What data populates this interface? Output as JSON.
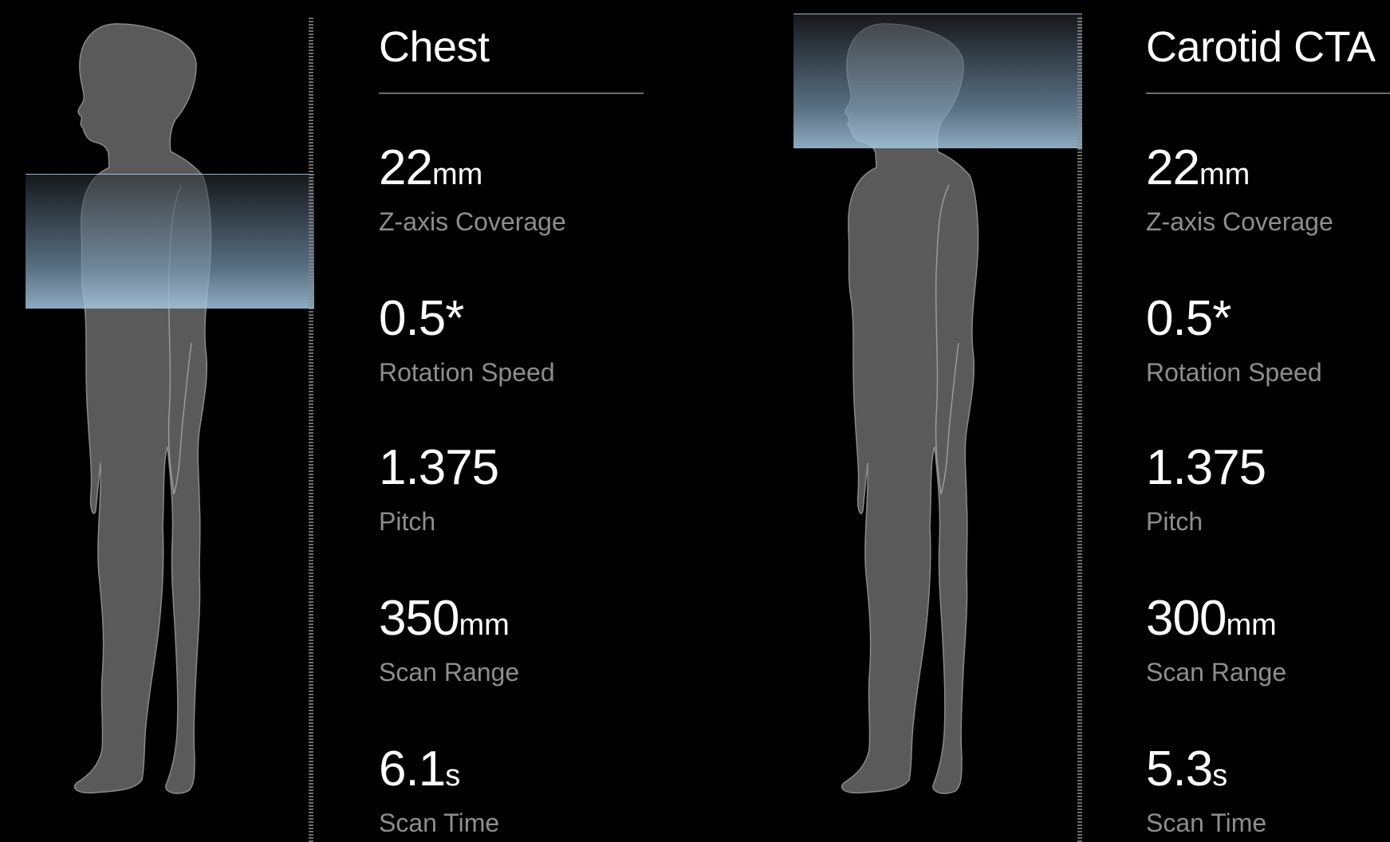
{
  "panels": [
    {
      "title": "Chest",
      "stats": [
        {
          "value": "22",
          "unit": "mm",
          "label": "Z-axis Coverage"
        },
        {
          "value": "0.5*",
          "unit": "",
          "label": "Rotation Speed"
        },
        {
          "value": "1.375",
          "unit": "",
          "label": "Pitch"
        },
        {
          "value": "350",
          "unit": "mm",
          "label": "Scan Range"
        },
        {
          "value": "6.1",
          "unit": "s",
          "label": "Scan Time"
        }
      ]
    },
    {
      "title": "Carotid CTA",
      "stats": [
        {
          "value": "22",
          "unit": "mm",
          "label": "Z-axis Coverage"
        },
        {
          "value": "0.5*",
          "unit": "",
          "label": "Rotation Speed"
        },
        {
          "value": "1.375",
          "unit": "",
          "label": "Pitch"
        },
        {
          "value": "300",
          "unit": "mm",
          "label": "Scan Range"
        },
        {
          "value": "5.3",
          "unit": "s",
          "label": "Scan Time"
        }
      ]
    }
  ],
  "colors": {
    "background": "#000000",
    "body": "#5a5a5a",
    "scan_band": "#a5c8e1",
    "label": "#8e8e8e"
  }
}
